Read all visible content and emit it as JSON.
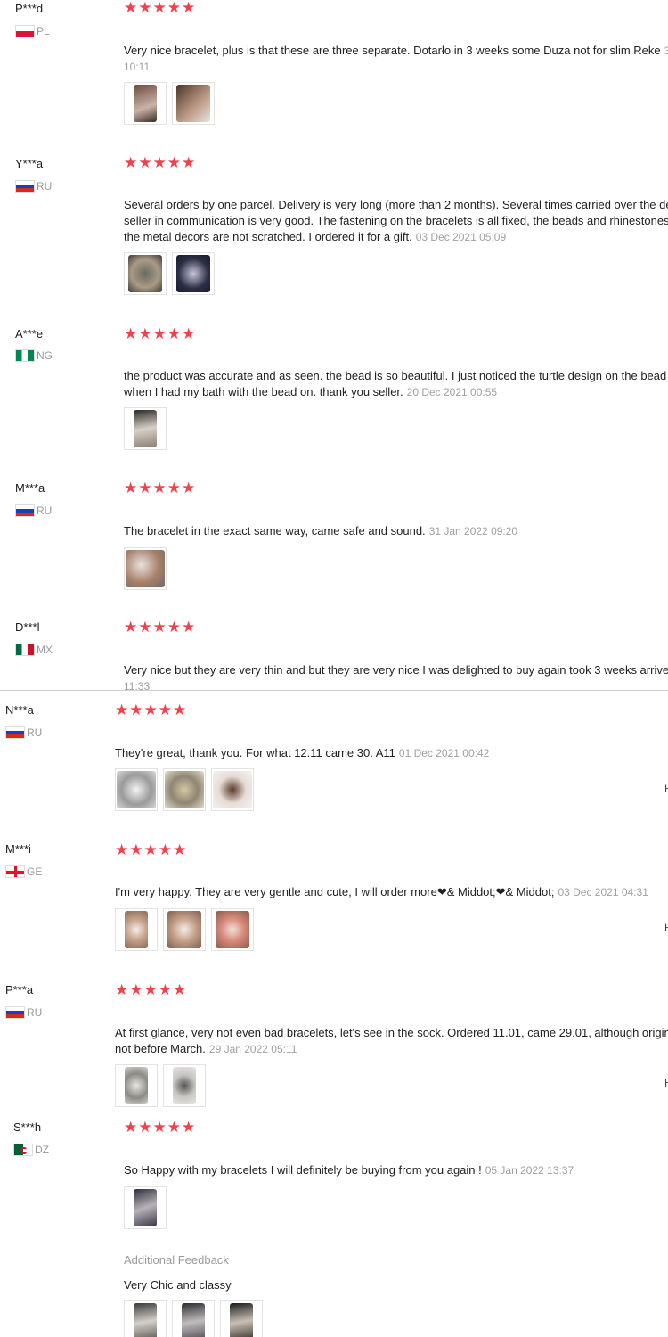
{
  "colors": {
    "star": "#f0424b",
    "date": "#a0a0a0",
    "country": "#9a9a9a"
  },
  "reviews": [
    {
      "user": "P***d",
      "country": "PL",
      "stars": "★★★★★",
      "text1": "Very nice bracelet, plus is that these are three separate. Dotarło in 3 weeks some Duza not for slim Reke",
      "date_inline": "3",
      "text2": "",
      "date": "10:11"
    },
    {
      "user": "Y***a",
      "country": "RU",
      "stars": "★★★★★",
      "text1": "Several orders by one parcel. Delivery is very long (more than 2 months). Several times carried over the de",
      "text2": "seller in communication is very good. The fastening on the bracelets is all fixed, the beads and rhinestones",
      "text3": "the metal decors are not scratched. I ordered it for a gift.",
      "date": "03 Dec 2021 05:09"
    },
    {
      "user": "A***e",
      "country": "NG",
      "stars": "★★★★★",
      "text1": "the product was accurate and as seen. the bead is so beautiful. I just noticed the turtle design on the bead",
      "text2": "when I had my bath with the bead on. thank you seller.",
      "date": "20 Dec 2021 00:55"
    },
    {
      "user": "M***a",
      "country": "RU",
      "stars": "★★★★★",
      "text1": "The bracelet in the exact same way, came safe and sound.",
      "date": "31 Jan 2022 09:20"
    },
    {
      "user": "D***l",
      "country": "MX",
      "stars": "★★★★★",
      "text1": "Very nice but they are very thin and but they are very nice I was delighted to buy again took 3 weeks arrive",
      "date": "11:33"
    },
    {
      "user": "N***a",
      "country": "RU",
      "stars": "★★★★★",
      "text1": "They're great, thank you. For what 12.11 came 30. A11",
      "date": "01 Dec 2021 00:42",
      "mark": "H"
    },
    {
      "user": "M***i",
      "country": "GE",
      "stars": "★★★★★",
      "text1": "I'm very happy. They are very gentle and cute, I will order more❤& Middot;❤& Middot;",
      "date": "03 Dec 2021 04:31",
      "mark": "H"
    },
    {
      "user": "P***a",
      "country": "RU",
      "stars": "★★★★★",
      "text1": "At first glance, very not even bad bracelets, let's see in the sock. Ordered 11.01, came 29.01, although origina",
      "text2": "not before March.",
      "date": "29 Jan 2022 05:11",
      "mark": "H"
    },
    {
      "user": "S***h",
      "country": "DZ",
      "stars": "★★★★★",
      "text1": "So Happy with my bracelets I will definitely be buying from you again !",
      "date": "05 Jan 2022 13:37",
      "additional_label": "Additional Feedback",
      "additional_text": "Very Chic and classy"
    }
  ]
}
